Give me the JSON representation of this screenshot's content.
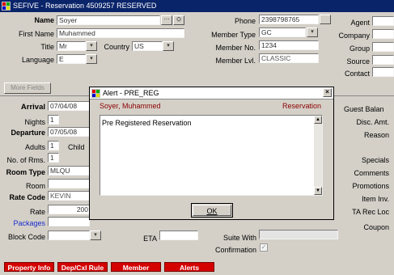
{
  "window": {
    "title": "SEFIVE - Reservation 4509257  RESERVED"
  },
  "guest": {
    "name_label": "Name",
    "name_value": "Soyer",
    "first_name_label": "First Name",
    "first_name_value": "Muhammed",
    "title_label": "Title",
    "title_value": "Mr",
    "country_label": "Country",
    "country_value": "US",
    "language_label": "Language",
    "language_value": "E",
    "phone_label": "Phone",
    "phone_value": "2398798765",
    "member_type_label": "Member Type",
    "member_type_value": "GC",
    "member_no_label": "Member No.",
    "member_no_value": "1234",
    "member_lvl_label": "Member Lvl.",
    "member_lvl_value": "CLASSIC",
    "agent_label": "Agent",
    "company_label": "Company",
    "group_label": "Group",
    "source_label": "Source",
    "contact_label": "Contact",
    "more_fields_label": "More Fields"
  },
  "reservation": {
    "arrival_label": "Arrival",
    "arrival_value": "07/04/08",
    "nights_label": "Nights",
    "nights_value": "1",
    "departure_label": "Departure",
    "departure_value": "07/05/08",
    "adults_label": "Adults",
    "adults_value": "1",
    "child_label": "Child",
    "no_rms_label": "No. of Rms.",
    "no_rms_value": "1",
    "room_type_label": "Room Type",
    "room_type_value": "MLQU",
    "room_label": "Room",
    "rate_code_label": "Rate Code",
    "rate_code_value": "KEVIN",
    "rate_label": "Rate",
    "rate_value": "200",
    "packages_label": "Packages",
    "block_code_label": "Block Code",
    "eta_label": "ETA",
    "suite_with_label": "Suite With",
    "confirmation_label": "Confirmation"
  },
  "right_panel": {
    "guest_balance_label": "Guest Balan",
    "disc_amt_label": "Disc. Amt.",
    "reason_label": "Reason",
    "specials_label": "Specials",
    "comments_label": "Comments",
    "promotions_label": "Promotions",
    "item_inv_label": "Item Inv.",
    "ta_rec_loc_label": "TA Rec Loc",
    "coupon_label": "Coupon"
  },
  "bottom_bar": {
    "property_info": "Property Info",
    "dep_cxl_rule": "Dep/Cxl Rule",
    "member": "Member",
    "alerts": "Alerts"
  },
  "alert_dialog": {
    "title": "Alert - PRE_REG",
    "guest_name": "Soyer, Muhammed",
    "area": "Reservation",
    "message": "Pre Registered Reservation",
    "ok_label": "OK"
  },
  "colors": {
    "title_bar": "#0a246a",
    "label_red": "#8b0000",
    "link_blue": "#1a2ccf",
    "button_red": "#d40000"
  }
}
